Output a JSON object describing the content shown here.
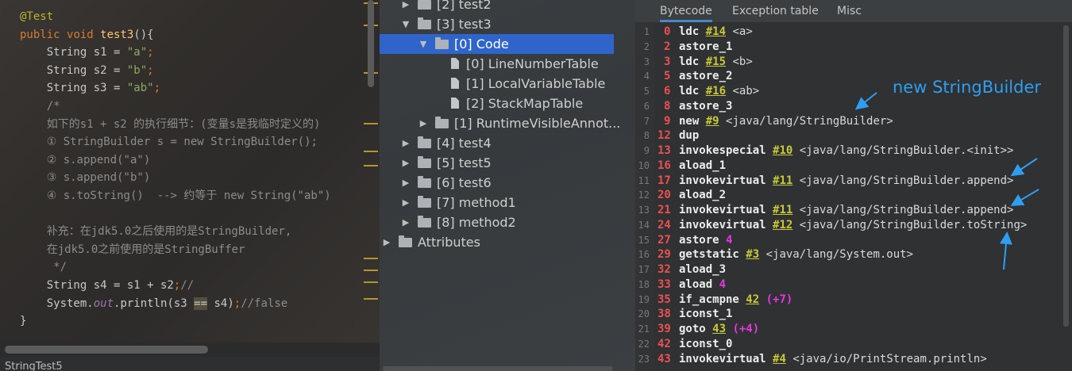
{
  "editor": {
    "lines": [
      {
        "parts": [
          {
            "t": "@Test",
            "c": "ann"
          }
        ]
      },
      {
        "parts": [
          {
            "t": "public ",
            "c": "kw"
          },
          {
            "t": "void ",
            "c": "kw"
          },
          {
            "t": "test3",
            "c": "fn"
          },
          {
            "t": "(){",
            "c": ""
          }
        ]
      },
      {
        "parts": [
          {
            "t": "    String s1 = ",
            "c": ""
          },
          {
            "t": "\"a\"",
            "c": "str"
          },
          {
            "t": ";",
            "c": "kw"
          }
        ]
      },
      {
        "parts": [
          {
            "t": "    String s2 = ",
            "c": ""
          },
          {
            "t": "\"b\"",
            "c": "str"
          },
          {
            "t": ";",
            "c": "kw"
          }
        ]
      },
      {
        "parts": [
          {
            "t": "    String s3 = ",
            "c": ""
          },
          {
            "t": "\"ab\"",
            "c": "str"
          },
          {
            "t": ";",
            "c": "kw"
          }
        ]
      },
      {
        "parts": [
          {
            "t": "    /*",
            "c": "cmt"
          }
        ]
      },
      {
        "parts": [
          {
            "t": "    如下的s1 + s2 的执行细节：(变量s是我临时定义的)",
            "c": "cmt"
          }
        ]
      },
      {
        "parts": [
          {
            "t": "    ① StringBuilder s = new StringBuilder();",
            "c": "cmt"
          }
        ]
      },
      {
        "parts": [
          {
            "t": "    ② s.append(\"a\")",
            "c": "cmt"
          }
        ]
      },
      {
        "parts": [
          {
            "t": "    ③ s.append(\"b\")",
            "c": "cmt"
          }
        ]
      },
      {
        "parts": [
          {
            "t": "    ④ s.toString()  --> 约等于 new String(\"ab\")",
            "c": "cmt"
          }
        ]
      },
      {
        "parts": [
          {
            "t": "",
            "c": ""
          }
        ]
      },
      {
        "parts": [
          {
            "t": "    补充：在jdk5.0之后使用的是StringBuilder,",
            "c": "cmt"
          }
        ]
      },
      {
        "parts": [
          {
            "t": "    在jdk5.0之前使用的是StringBuffer",
            "c": "cmt"
          }
        ]
      },
      {
        "parts": [
          {
            "t": "     */",
            "c": "cmt"
          }
        ]
      },
      {
        "parts": [
          {
            "t": "    String s4 = s1 + s2",
            "c": ""
          },
          {
            "t": ";",
            "c": "kw"
          },
          {
            "t": "//",
            "c": "cmt"
          }
        ]
      },
      {
        "parts": [
          {
            "t": "    System.",
            "c": ""
          },
          {
            "t": "out",
            "c": "fld"
          },
          {
            "t": ".println(s3 ",
            "c": ""
          },
          {
            "t": "==",
            "c": "eqh"
          },
          {
            "t": " s4)",
            "c": ""
          },
          {
            "t": ";",
            "c": "kw"
          },
          {
            "t": "//false",
            "c": "cmt"
          }
        ]
      },
      {
        "parts": [
          {
            "t": "}",
            "c": ""
          }
        ]
      }
    ],
    "file_tab": "StringTest5"
  },
  "tree": {
    "rows": [
      {
        "label": "[2] test2",
        "kind": "folder",
        "arrow": "▶",
        "indent": 1,
        "selected": false
      },
      {
        "label": "[3] test3",
        "kind": "folder",
        "arrow": "▼",
        "indent": 1,
        "selected": false
      },
      {
        "label": "[0] Code",
        "kind": "folder",
        "arrow": "▼",
        "indent": 2,
        "selected": true
      },
      {
        "label": "[0] LineNumberTable",
        "kind": "file",
        "arrow": "",
        "indent": 3,
        "selected": false
      },
      {
        "label": "[1] LocalVariableTable",
        "kind": "file",
        "arrow": "",
        "indent": 3,
        "selected": false
      },
      {
        "label": "[2] StackMapTable",
        "kind": "file",
        "arrow": "",
        "indent": 3,
        "selected": false
      },
      {
        "label": "[1] RuntimeVisibleAnnot...",
        "kind": "folder",
        "arrow": "▶",
        "indent": 2,
        "selected": false
      },
      {
        "label": "[4] test4",
        "kind": "folder",
        "arrow": "▶",
        "indent": 1,
        "selected": false
      },
      {
        "label": "[5] test5",
        "kind": "folder",
        "arrow": "▶",
        "indent": 1,
        "selected": false
      },
      {
        "label": "[6] test6",
        "kind": "folder",
        "arrow": "▶",
        "indent": 1,
        "selected": false
      },
      {
        "label": "[7] method1",
        "kind": "folder",
        "arrow": "▶",
        "indent": 1,
        "selected": false
      },
      {
        "label": "[8] method2",
        "kind": "folder",
        "arrow": "▶",
        "indent": 1,
        "selected": false
      },
      {
        "label": "Attributes",
        "kind": "folder",
        "arrow": "▶",
        "indent": 0,
        "selected": false
      }
    ]
  },
  "bytecode": {
    "tabs": [
      "Bytecode",
      "Exception table",
      "Misc"
    ],
    "active_tab": 0,
    "annotation": "new StringBuilder",
    "annotation_color": "#2f9ef0",
    "lines": [
      {
        "n": "1",
        "off": "0",
        "op": "ldc",
        "cp": "#14",
        "ref": "<a>",
        "extra": ""
      },
      {
        "n": "2",
        "off": "2",
        "op": "astore_1",
        "cp": "",
        "ref": "",
        "extra": ""
      },
      {
        "n": "3",
        "off": "3",
        "op": "ldc",
        "cp": "#15",
        "ref": "<b>",
        "extra": ""
      },
      {
        "n": "4",
        "off": "5",
        "op": "astore_2",
        "cp": "",
        "ref": "",
        "extra": ""
      },
      {
        "n": "5",
        "off": "6",
        "op": "ldc",
        "cp": "#16",
        "ref": "<ab>",
        "extra": ""
      },
      {
        "n": "6",
        "off": "8",
        "op": "astore_3",
        "cp": "",
        "ref": "",
        "extra": ""
      },
      {
        "n": "7",
        "off": "9",
        "op": "new",
        "cp": "#9",
        "ref": "<java/lang/StringBuilder>",
        "extra": ""
      },
      {
        "n": "8",
        "off": "12",
        "op": "dup",
        "cp": "",
        "ref": "",
        "extra": ""
      },
      {
        "n": "9",
        "off": "13",
        "op": "invokespecial",
        "cp": "#10",
        "ref": "<java/lang/StringBuilder.<init>>",
        "extra": ""
      },
      {
        "n": "10",
        "off": "16",
        "op": "aload_1",
        "cp": "",
        "ref": "",
        "extra": ""
      },
      {
        "n": "11",
        "off": "17",
        "op": "invokevirtual",
        "cp": "#11",
        "ref": "<java/lang/StringBuilder.append>",
        "extra": ""
      },
      {
        "n": "12",
        "off": "20",
        "op": "aload_2",
        "cp": "",
        "ref": "",
        "extra": ""
      },
      {
        "n": "13",
        "off": "21",
        "op": "invokevirtual",
        "cp": "#11",
        "ref": "<java/lang/StringBuilder.append>",
        "extra": ""
      },
      {
        "n": "14",
        "off": "24",
        "op": "invokevirtual",
        "cp": "#12",
        "ref": "<java/lang/StringBuilder.toString>",
        "extra": ""
      },
      {
        "n": "15",
        "off": "27",
        "op": "astore",
        "cp": "",
        "ref": "",
        "extra": "4"
      },
      {
        "n": "16",
        "off": "29",
        "op": "getstatic",
        "cp": "#3",
        "ref": "<java/lang/System.out>",
        "extra": ""
      },
      {
        "n": "17",
        "off": "32",
        "op": "aload_3",
        "cp": "",
        "ref": "",
        "extra": ""
      },
      {
        "n": "18",
        "off": "33",
        "op": "aload",
        "cp": "",
        "ref": "",
        "extra": "4"
      },
      {
        "n": "19",
        "off": "35",
        "op": "if_acmpne",
        "cp": "42",
        "ref": "",
        "extra": "(+7)"
      },
      {
        "n": "20",
        "off": "38",
        "op": "iconst_1",
        "cp": "",
        "ref": "",
        "extra": ""
      },
      {
        "n": "21",
        "off": "39",
        "op": "goto",
        "cp": "43",
        "ref": "",
        "extra": "(+4)"
      },
      {
        "n": "22",
        "off": "42",
        "op": "iconst_0",
        "cp": "",
        "ref": "",
        "extra": ""
      },
      {
        "n": "23",
        "off": "43",
        "op": "invokevirtual",
        "cp": "#4",
        "ref": "<java/io/PrintStream.println>",
        "extra": ""
      }
    ]
  }
}
